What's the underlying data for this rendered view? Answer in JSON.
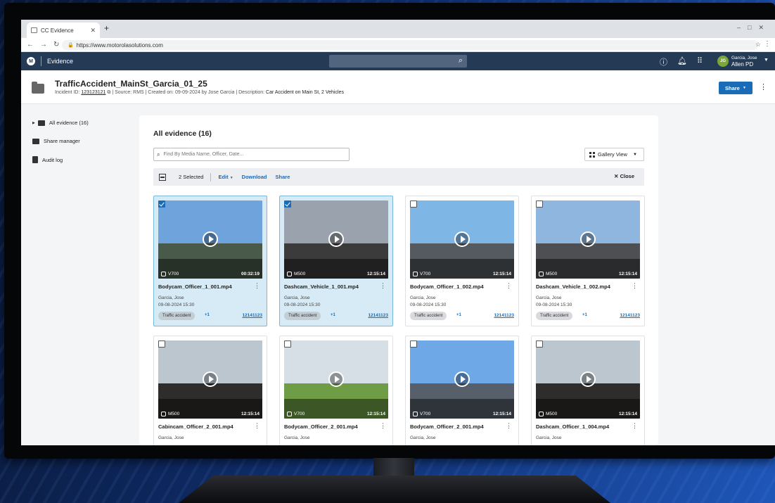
{
  "browser": {
    "tab_title": "CC Evidence",
    "url": "https://www.motorolasolutions.com"
  },
  "app": {
    "name": "Evidence",
    "user_initials": "JG",
    "user_name": "Garcia, Jose",
    "user_org": "Allen PD",
    "header_bg": "#243a55"
  },
  "case": {
    "title": "TrafficAccident_MainSt_Garcia_01_25",
    "incident_label": "Incident ID:",
    "incident_id": "123123121",
    "source": "| Source: RMS",
    "created": "| Created on: 09-09-2024 by Jose Garcia",
    "desc_label": "| Description:",
    "description": "Car Accident on Main St, 2 Vehicles",
    "share_label": "Share"
  },
  "sidebar": {
    "items": [
      {
        "label": "All evidence (16)"
      },
      {
        "label": "Share manager"
      },
      {
        "label": "Audit log"
      }
    ]
  },
  "main": {
    "title": "All evidence (16)",
    "search_placeholder": "Find By Media Name, Officer, Date...",
    "view_label": "Gallery View",
    "selected_count": "2 Selected",
    "edit_label": "Edit",
    "download_label": "Download",
    "share_label": "Share",
    "close_label": "Close"
  },
  "cards": [
    {
      "name": "Bodycam_Officer_1_001.mp4",
      "device": "V700",
      "duration": "00:32:19",
      "officer": "Garcia, Jose",
      "date": "09-08-2024 15:30",
      "tag": "Traffic accident",
      "more": "+1",
      "incident": "12141123",
      "selected": true
    },
    {
      "name": "Dashcam_Vehicle_1_001.mp4",
      "device": "M500",
      "duration": "12:15:14",
      "officer": "Garcia, Jose",
      "date": "09-08-2024 15:30",
      "tag": "Traffic accident",
      "more": "+1",
      "incident": "12141123",
      "selected": true
    },
    {
      "name": "Bodycam_Officer_1_002.mp4",
      "device": "V700",
      "duration": "12:15:14",
      "officer": "Garcia, Jose",
      "date": "09-08-2024 15:30",
      "tag": "Traffic accident",
      "more": "+1",
      "incident": "12141123",
      "selected": false
    },
    {
      "name": "Dashcam_Vehicle_1_002.mp4",
      "device": "M500",
      "duration": "12:15:14",
      "officer": "Garcia, Jose",
      "date": "09-08-2024 15:30",
      "tag": "Traffic accident",
      "more": "+1",
      "incident": "12141123",
      "selected": false
    },
    {
      "name": "Cabincam_Officer_2_001.mp4",
      "device": "M500",
      "duration": "12:15:14",
      "officer": "Garcia, Jose",
      "selected": false
    },
    {
      "name": "Bodycam_Officer_2_001.mp4",
      "device": "V700",
      "duration": "12:15:14",
      "officer": "Garcia, Jose",
      "selected": false
    },
    {
      "name": "Bodycam_Officer_2_001.mp4",
      "device": "V700",
      "duration": "12:15:14",
      "officer": "Garcia, Jose",
      "selected": false
    },
    {
      "name": "Dashcam_Officer_1_004.mp4",
      "device": "M500",
      "duration": "12:15:14",
      "officer": "Garcia, Jose",
      "selected": false
    }
  ]
}
